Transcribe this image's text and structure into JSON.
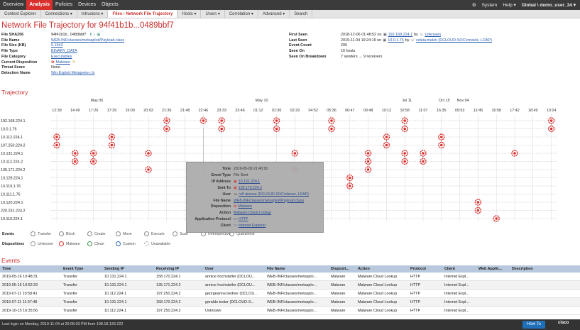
{
  "topnav": {
    "items": [
      "Overview",
      "Analysis",
      "Policies",
      "Devices",
      "Objects"
    ],
    "active_index": 1,
    "system": "System",
    "help": "Help ▾",
    "user": "Global \\ demo_user_34 ▾"
  },
  "subnav": {
    "items": [
      "Context Explorer",
      "Connections ▾",
      "Intrusions ▾",
      "Files › Network File Trajectory",
      "Hosts ▾",
      "Users ▾",
      "Correlation ▾",
      "Advanced ▾",
      "Search"
    ],
    "active_index": 3
  },
  "page_title": "Network File Trajectory for 94f41b1b...0489bbf7",
  "file_info_left": [
    {
      "label": "File SHA256",
      "value": "94f41b1b...0489bbf7"
    },
    {
      "label": "File Name",
      "value": "WEB-INF/classes/metasploit/Payload.class",
      "link": true
    },
    {
      "label": "File Size (KB)",
      "value": "5.1943",
      "link": true
    },
    {
      "label": "File Type",
      "value": "BINARY_DATA",
      "link": true
    },
    {
      "label": "File Category",
      "value": "Executables",
      "link": true
    },
    {
      "label": "Current Disposition",
      "value": "Malware",
      "link": true
    },
    {
      "label": "Threat Score",
      "value": "None"
    },
    {
      "label": "Detection Name",
      "value": "Win.Exploit.Metapreter::lc",
      "link": true
    }
  ],
  "file_info_right": [
    {
      "label": "First Seen",
      "value": "2018-12-06 01:48:52 on",
      "link_text": "192.168.224.1",
      "extra": "by",
      "extra_link": "Unknown"
    },
    {
      "label": "Last Seen",
      "value": "2019-11-04 19:24:19 on",
      "link_text": "10.0.1.76",
      "extra": "by",
      "extra_link": "celeia.malek (DCLOUD-SOC\\cmalek, LDAP)"
    },
    {
      "label": "Event Count",
      "value": "200"
    },
    {
      "label": "Seen On",
      "value": "16 hosts"
    },
    {
      "label": "Seen On Breakdown",
      "value": "7 senders → 9 receivers"
    }
  ],
  "trajectory": {
    "title": "Trajectory",
    "date_labels": [
      {
        "text": "May 05",
        "col": 2
      },
      {
        "text": "May 10",
        "col": 11
      },
      {
        "text": "Jul 11",
        "col": 19
      },
      {
        "text": "Oct 15",
        "col": 21
      },
      {
        "text": "Nov 04",
        "col": 22
      }
    ],
    "times": [
      "12:39",
      "14:49",
      "17:26",
      "17:39",
      "19:00",
      "20:03",
      "21:36",
      "21:48",
      "22:46",
      "23:33",
      "23:46",
      "01:12",
      "01:36",
      "02:29",
      "04:52",
      "05:36",
      "06:47",
      "09:48",
      "10:12",
      "10:58",
      "11:07",
      "16:35",
      "09:53",
      "12:45",
      "16:58",
      "17:42",
      "18:49",
      "19:24"
    ],
    "hosts": [
      "192.168.224.1",
      "10.0.1.76",
      "10.112.224.1",
      "197.250.224.2",
      "10.131.224.1",
      "10.112.224.2",
      "135.171.224.2",
      "10.128.224.1",
      "10.119.1.76",
      "10.111.1.76",
      "10.120.224.1",
      "220.231.224.2",
      "10.110.224.1"
    ],
    "markers": [
      [
        0,
        6
      ],
      [
        0,
        8
      ],
      [
        0,
        9
      ],
      [
        0,
        12
      ],
      [
        0,
        15
      ],
      [
        0,
        19
      ],
      [
        0,
        27
      ],
      [
        1,
        6
      ],
      [
        1,
        9
      ],
      [
        1,
        12
      ],
      [
        1,
        15
      ],
      [
        1,
        19
      ],
      [
        1,
        27
      ],
      [
        2,
        0
      ],
      [
        2,
        3
      ],
      [
        2,
        18
      ],
      [
        2,
        21
      ],
      [
        3,
        0
      ],
      [
        3,
        3
      ],
      [
        3,
        18
      ],
      [
        3,
        21
      ],
      [
        4,
        1
      ],
      [
        4,
        2
      ],
      [
        4,
        5
      ],
      [
        4,
        13
      ],
      [
        4,
        17
      ],
      [
        4,
        19
      ],
      [
        4,
        20
      ],
      [
        4,
        25
      ],
      [
        5,
        1
      ],
      [
        5,
        2
      ],
      [
        5,
        17
      ],
      [
        5,
        19
      ],
      [
        5,
        20
      ],
      [
        6,
        5
      ],
      [
        6,
        13
      ],
      [
        6,
        17
      ],
      [
        7,
        16
      ],
      [
        8,
        16
      ],
      [
        10,
        23
      ],
      [
        11,
        23
      ],
      [
        12,
        24
      ]
    ],
    "events": [
      [
        2,
        1
      ],
      [
        5,
        3
      ],
      [
        6,
        6
      ],
      [
        8,
        9
      ],
      [
        9,
        2
      ],
      [
        10,
        4
      ],
      [
        11,
        7
      ]
    ]
  },
  "legend": {
    "events_label": "Events",
    "event_types": [
      "Transfer",
      "Block",
      "Create",
      "Move",
      "Execute",
      "Scan",
      "Retrospective",
      "Quarantine"
    ],
    "dispositions_label": "Dispositions",
    "disposition_types": [
      "Unknown",
      "Malware",
      "Clean",
      "Custom",
      "Unavailable"
    ]
  },
  "popup": {
    "rows": [
      {
        "label": "Time",
        "value": "2019-05-09 21:40:16"
      },
      {
        "label": "Event Type",
        "value": "File Sent"
      },
      {
        "label": "IP Address",
        "value": "10.131.224.1",
        "link": true
      },
      {
        "label": "Sent To",
        "value": "158.170.224.2",
        "link": true
      },
      {
        "label": "User",
        "value": "rolf devose (DCLOUD-SOC\\rdevos, LDAP)",
        "link": true
      },
      {
        "label": "File Name",
        "value": "WEB-INF/classes/metasploit/Payload.class",
        "link": true
      },
      {
        "label": "Disposition",
        "value": "Malware",
        "link": true
      },
      {
        "label": "Action",
        "value": "Malware Cloud Lookup",
        "link": true
      },
      {
        "label": "Application Protocol",
        "value": "HTTP",
        "link": true
      },
      {
        "label": "Client",
        "value": "Internet Explorer",
        "link": true
      }
    ]
  },
  "events_table": {
    "title": "Events",
    "columns": [
      "Time",
      "Event Type",
      "Sending IP",
      "Receiving IP",
      "User",
      "File Name",
      "Disposit...",
      "Action",
      "Protocol",
      "Client",
      "Web Applic...",
      "Description"
    ],
    "rows": [
      [
        "2019-05-16 10:48:31",
        "Transfer",
        "10.131.224.1",
        "158.170.224.1",
        "annice hochstetler (DCLOU...",
        "WEB-INF/classes/metasplo...",
        "Malware",
        "Malware Cloud Lookup",
        "HTTP",
        "Internet Expl...",
        "",
        ""
      ],
      [
        "2019-05-16 10:52:29",
        "Transfer",
        "10.131.224.1",
        "135.171.224.2",
        "annice hochstetler (DCLOU...",
        "WEB-INF/classes/metasplo...",
        "Malware",
        "Malware Cloud Lookup",
        "HTTP",
        "Internet Expl...",
        "",
        ""
      ],
      [
        "2019-07-11 10:58:41",
        "Transfer",
        "10.112.224.1",
        "197.250.224.2",
        "georgeanna bedner (DCLOU...",
        "WEB-INF/classes/metasplo...",
        "Malware",
        "Malware Cloud Lookup",
        "HTTP",
        "Internet Expl...",
        "",
        ""
      ],
      [
        "2019-07-11 11:07:48",
        "Transfer",
        "10.131.224.1",
        "158.170.224.2",
        "geraldo tester (DCLOUD-S...",
        "WEB-INF/classes/metasplo...",
        "Malware",
        "Malware Cloud Lookup",
        "HTTP",
        "Internet Expl...",
        "",
        ""
      ],
      [
        "2019-10-15 16:35:56",
        "Transfer",
        "10.112.224.1",
        "197.250.224.2",
        "Unknown",
        "WEB-INF/classes/metasplo...",
        "Malware",
        "Malware Cloud Lookup",
        "HTTP",
        "Internet Expl...",
        "",
        ""
      ]
    ]
  },
  "statusbar": {
    "text": "Last login on Monday, 2019-11-04 at 20:05:03 PM from 198.18.133.222",
    "howto": "How To",
    "brand": "cisco"
  },
  "colors": {
    "accent": "#c8302e",
    "malware": "#d9302e",
    "nav": "#3b3b3b"
  }
}
